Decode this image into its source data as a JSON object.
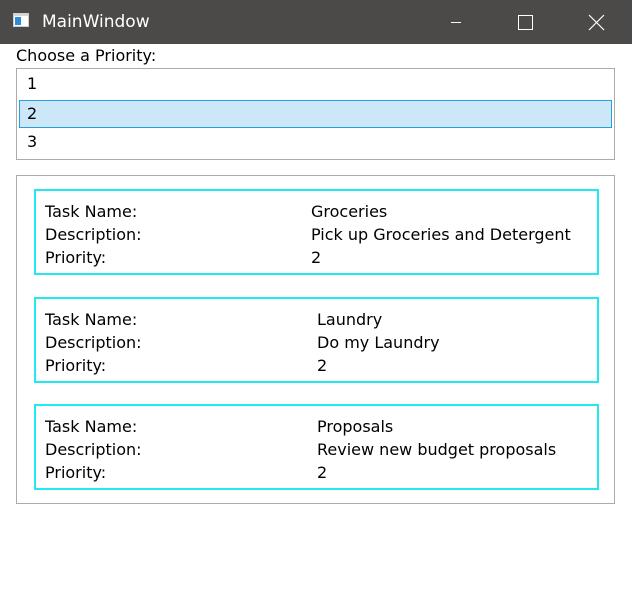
{
  "window": {
    "title": "MainWindow"
  },
  "priority": {
    "label": "Choose a Priority:",
    "options": [
      "1",
      "2",
      "3"
    ],
    "selected": "2"
  },
  "field_labels": {
    "name": "Task Name:",
    "description": "Description:",
    "priority": "Priority:"
  },
  "tasks": [
    {
      "name": "Groceries",
      "description": "Pick up Groceries and Detergent",
      "priority": "2"
    },
    {
      "name": "Laundry",
      "description": "Do my Laundry",
      "priority": "2"
    },
    {
      "name": "Proposals",
      "description": "Review new budget proposals",
      "priority": "2"
    }
  ],
  "colors": {
    "titlebar": "#4b4a48",
    "selection_bg": "#cce8f8",
    "selection_border": "#26a0da",
    "card_border": "#22e8ef"
  }
}
